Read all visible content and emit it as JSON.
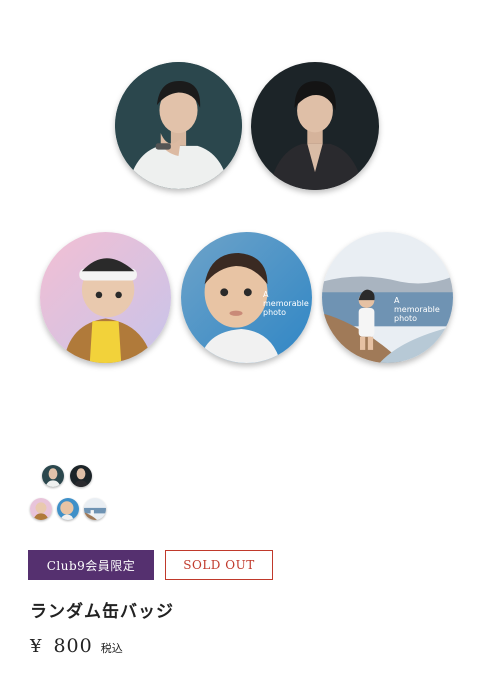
{
  "product": {
    "badge_captions": {
      "badge4": "A memorable photo",
      "badge5": "A memorable photo"
    },
    "members_tag": "Club9会員限定",
    "status": "SOLD OUT",
    "title": "ランダム缶バッジ",
    "price": {
      "currency": "¥",
      "amount": "800",
      "tax_note": "税込"
    }
  },
  "colors": {
    "members_tag_bg": "#55306f",
    "soldout_accent": "#c0392b"
  }
}
